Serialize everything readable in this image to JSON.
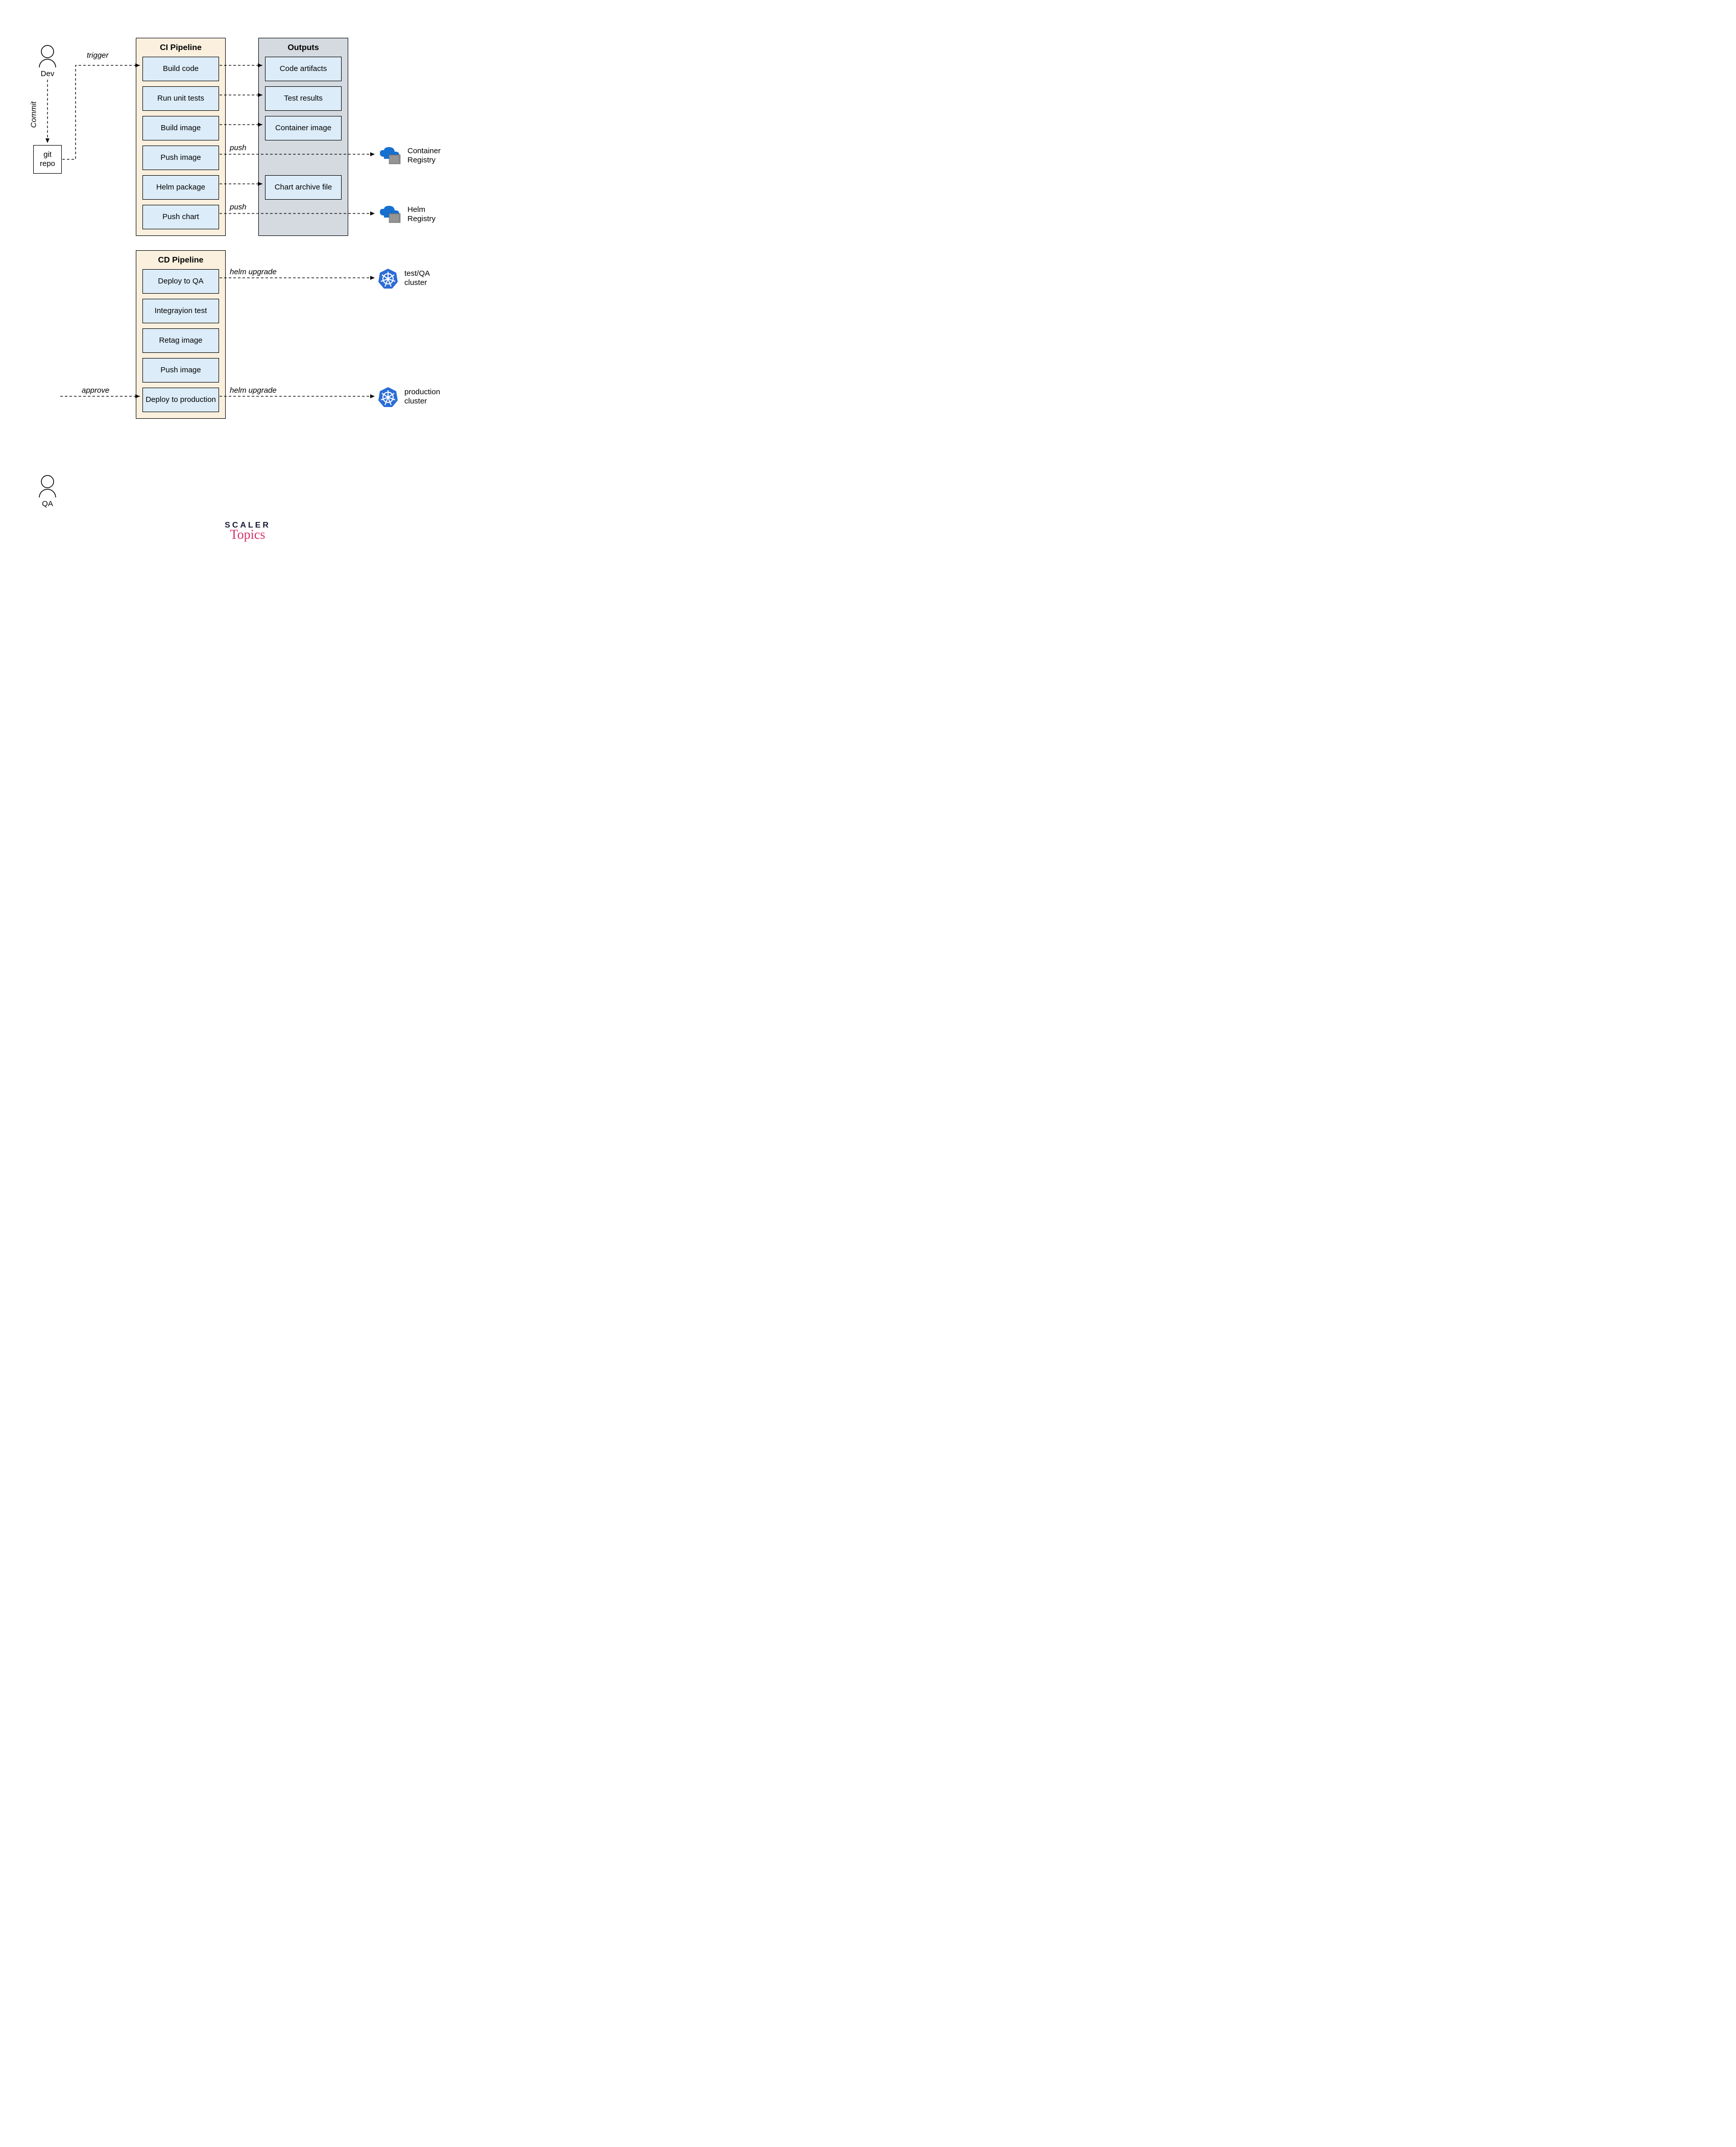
{
  "actors": {
    "dev": "Dev",
    "qa": "QA"
  },
  "git": {
    "label": "git\nrepo"
  },
  "labels": {
    "commit": "Commit",
    "trigger": "trigger",
    "push1": "push",
    "push2": "push",
    "helm_upgrade_qa": "helm upgrade",
    "helm_upgrade_prod": "helm upgrade",
    "approve": "approve"
  },
  "ci": {
    "title": "CI Pipeline",
    "stages": [
      "Build code",
      "Run unit tests",
      "Build image",
      "Push image",
      "Helm package",
      "Push chart"
    ]
  },
  "outputs": {
    "title": "Outputs",
    "items": [
      "Code artifacts",
      "Test results",
      "Container image",
      "",
      "Chart archive file"
    ]
  },
  "cd": {
    "title": "CD Pipeline",
    "stages": [
      "Deploy to QA",
      "Integrayion test",
      "Retag image",
      "Push image",
      "Deploy to production"
    ]
  },
  "targets": {
    "container_registry": "Container Registry",
    "helm_registry": "Helm Registry",
    "qa_cluster": "test/QA cluster",
    "prod_cluster": "production cluster"
  },
  "branding": {
    "top": "SCALER",
    "bottom": "Topics"
  }
}
